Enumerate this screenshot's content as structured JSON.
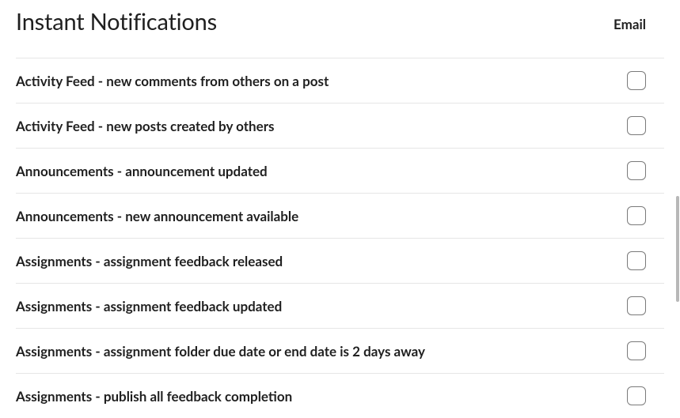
{
  "header": {
    "title": "Instant Notifications",
    "column": "Email"
  },
  "rows": [
    {
      "label": "Activity Feed - new comments from others on a post",
      "checked": false
    },
    {
      "label": "Activity Feed - new posts created by others",
      "checked": false
    },
    {
      "label": "Announcements - announcement updated",
      "checked": false
    },
    {
      "label": "Announcements - new announcement available",
      "checked": false
    },
    {
      "label": "Assignments - assignment feedback released",
      "checked": false
    },
    {
      "label": "Assignments - assignment feedback updated",
      "checked": false
    },
    {
      "label": "Assignments - assignment folder due date or end date is 2 days away",
      "checked": false
    },
    {
      "label": "Assignments - publish all feedback completion",
      "checked": false
    }
  ]
}
